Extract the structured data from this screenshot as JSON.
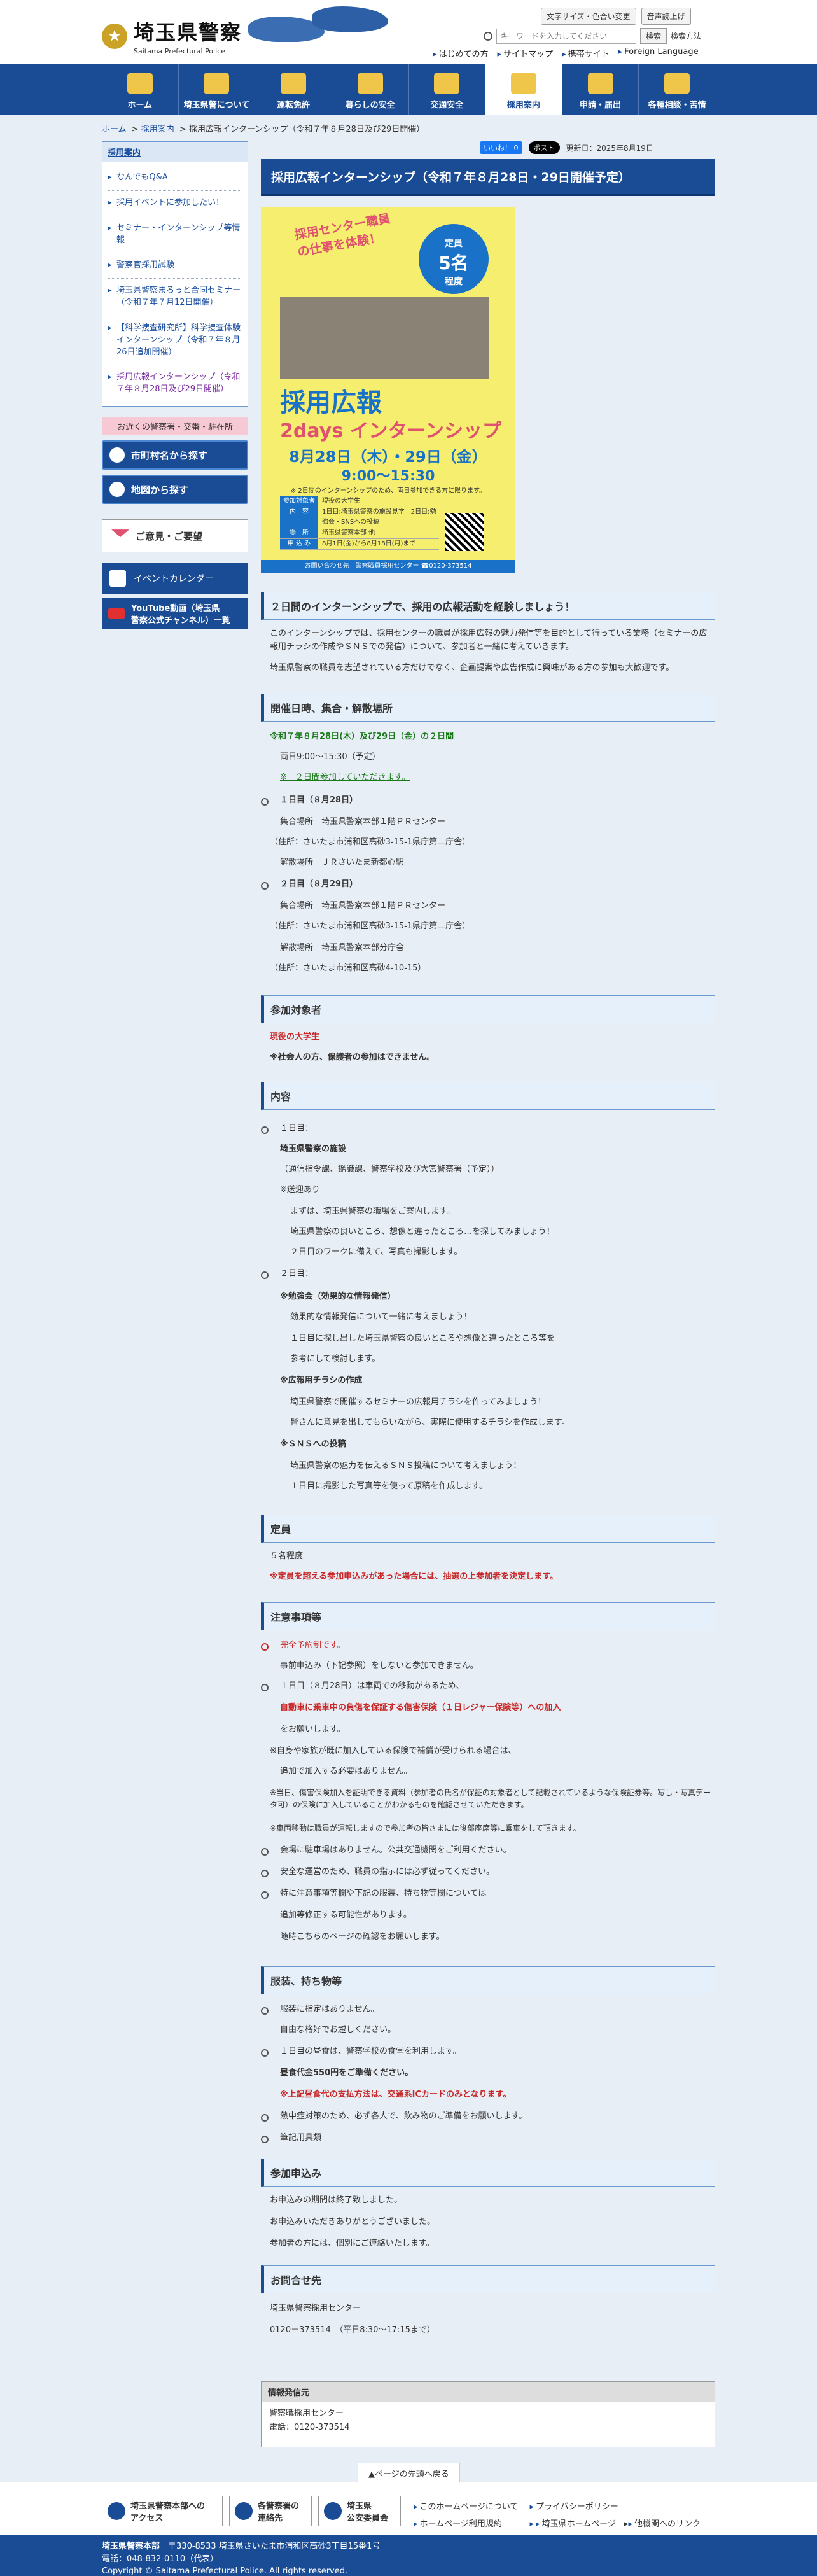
{
  "header": {
    "logo_ja": "埼玉県警察",
    "logo_en": "Saitama Prefectural Police",
    "btn_fontsize": "文字サイズ・色合い変更",
    "btn_voice": "音声読上げ",
    "search_placeholder": "キーワードを入力してください",
    "search_btn": "検索",
    "search_howto": "検索方法",
    "util": [
      "はじめての方",
      "サイトマップ",
      "携帯サイト",
      "Foreign Language"
    ]
  },
  "nav": [
    "ホーム",
    "埼玉県警について",
    "運転免許",
    "暮らしの安全",
    "交通安全",
    "採用案内",
    "申請・届出",
    "各種相談・苦情"
  ],
  "breadcrumb": {
    "home": "ホーム",
    "recruit": "採用案内",
    "current": "採用広報インターンシップ（令和７年８月28日及び29日開催）"
  },
  "sidebar": {
    "heading": "採用案内",
    "items": [
      "なんでもQ&A",
      "採用イベントに参加したい！",
      "セミナー・インターンシップ等情報",
      "警察官採用試験",
      "埼玉県警察まるっと合同セミナー（令和７年７月12日開催）",
      "【科学捜査研究所】科学捜査体験インターンシップ（令和７年８月26日追加開催）",
      "採用広報インターンシップ（令和７年８月28日及び29日開催）"
    ],
    "nearby": "お近くの警察署・交番・駐在所",
    "city_btn": "市町村名から探す",
    "map_btn": "地図から探す",
    "opinion": "ご意見・ご要望",
    "event": "イベントカレンダー",
    "youtube1": "YouTube動画（埼玉県",
    "youtube2": "警察公式チャンネル）一覧"
  },
  "meta": {
    "like": "いいね！ 0",
    "post": "ポスト",
    "updated": "更新日：2025年8月19日"
  },
  "page_title": "採用広報インターンシップ（令和７年８月28日・29日開催予定）",
  "poster": {
    "catch": "採用センター職員の仕事を体験！",
    "badge1": "定員",
    "badge2": "5名",
    "badge3": "程度",
    "title": "採用広報",
    "sub": "2days インターンシップ",
    "date": "8月28日（木）・29日（金）",
    "time": "9:00〜15:30",
    "note": "※ 2日間のインターンシップのため、両日参加できる方に限ります。",
    "rows": [
      [
        "参加対象者",
        "現役の大学生"
      ],
      [
        "内　容",
        "1日目:埼玉県警察の施設見学　2日目:勉強会・SNSへの投稿"
      ],
      [
        "場　所",
        "埼玉県警察本部 他"
      ],
      [
        "申 込 み",
        "8月1日(金)から8月18日(月)まで"
      ]
    ],
    "foot": "お問い合わせ先　警察職員採用センター ☎0120-373514"
  },
  "s1": {
    "h": "２日間のインターンシップで、採用の広報活動を経験しましょう！",
    "p1": "このインターンシップでは、採用センターの職員が採用広報の魅力発信等を目的として行っている業務（セミナーの広報用チラシの作成やＳＮＳでの発信）について、参加者と一緒に考えていきます。",
    "p2": "埼玉県警察の職員を志望されている方だけでなく、企画提案や広告作成に興味がある方の参加も大歓迎です。"
  },
  "s2": {
    "h": "開催日時、集合・解散場所",
    "date": "令和７年８月28日(木）及び29日（金）の２日間",
    "time": "両日9:00〜15:30（予定）",
    "note": "※　２日間参加していただきます。",
    "d1": "１日目（８月28日）",
    "d1a": "集合場所　埼玉県警察本部１階ＰＲセンター",
    "d1b": "（住所：さいたま市浦和区高砂3-15-1県庁第二庁舎）",
    "d1c": "解散場所　ＪＲさいたま新都心駅",
    "d2": "２日目（８月29日）",
    "d2a": "集合場所　埼玉県警察本部１階ＰＲセンター",
    "d2b": "（住所：さいたま市浦和区高砂3-15-1県庁第二庁舎）",
    "d2c": "解散場所　埼玉県警察本部分庁舎",
    "d2d": "（住所：さいたま市浦和区高砂4-10-15）"
  },
  "s3": {
    "h": "参加対象者",
    "p1": "現役の大学生",
    "p2": "※社会人の方、保護者の参加はできません。"
  },
  "s4": {
    "h": "内容",
    "day1": "１日目：",
    "day1a": "埼玉県警察の施設",
    "day1b": "（通信指令課、鑑識課、警察学校及び大宮警察署（予定））",
    "day1c": "※送迎あり",
    "day1d": "まずは、埼玉県警察の職場をご案内します。",
    "day1e": "埼玉県警察の良いところ、想像と違ったところ…を探してみましょう！",
    "day1f": "２日目のワークに備えて、写真も撮影します。",
    "day2": "２日目：",
    "w1": "※勉強会（効果的な情報発信）",
    "w1a": "効果的な情報発信について一緒に考えましょう！",
    "w1b": "１日目に探し出した埼玉県警察の良いところや想像と違ったところ等を",
    "w1c": "参考にして検討します。",
    "w2": "※広報用チラシの作成",
    "w2a": "埼玉県警察で開催するセミナーの広報用チラシを作ってみましょう！",
    "w2b": "皆さんに意見を出してもらいながら、実際に使用するチラシを作成します。",
    "w3": "※ＳＮＳへの投稿",
    "w3a": "埼玉県警察の魅力を伝えるＳＮＳ投稿について考えましょう！",
    "w3b": "１日目に撮影した写真等を使って原稿を作成します。"
  },
  "s5": {
    "h": "定員",
    "p1": "５名程度",
    "p2": "※定員を超える参加申込みがあった場合には、抽選の上参加者を決定します。"
  },
  "s6": {
    "h": "注意事項等",
    "a": "完全予約制です。",
    "a2": "事前申込み（下記参照）をしないと参加できません。",
    "b": "１日目（８月28日）は車両での移動があるため、",
    "b2": "自動車に乗車中の負傷を保証する傷害保険（１日レジャー保険等）への加入",
    "b3": "をお願いします。",
    "b4": "※自身や家族が既に加入している保険で補償が受けられる場合は、",
    "b5": "追加で加入する必要はありません。",
    "b6": "※当日、傷害保険加入を証明できる資料（参加者の氏名が保証の対象者として記載されているような保険証券等。写し・写真データ可）の保険に加入していることがわかるものを確認させていただきます。",
    "b7": "※車両移動は職員が運転しますので参加者の皆さまには後部座席等に乗車をして頂きます。",
    "c": "会場に駐車場はありません。公共交通機関をご利用ください。",
    "d": "安全な運営のため、職員の指示には必ず従ってください。",
    "e": "特に注意事項等欄や下記の服装、持ち物等欄については",
    "e2": "追加等修正する可能性があります。",
    "e3": "随時こちらのページの確認をお願いします。"
  },
  "s7": {
    "h": "服装、持ち物等",
    "a": "服装に指定はありません。",
    "a2": "自由な格好でお越しください。",
    "b": "１日目の昼食は、警察学校の食堂を利用します。",
    "b2": "昼食代金550円をご準備ください。",
    "b3": "※上記昼食代の支払方法は、交通系ICカードのみとなります。",
    "c": "熱中症対策のため、必ず各人で、飲み物のご準備をお願いします。",
    "d": "筆記用具類"
  },
  "s8": {
    "h": "参加申込み",
    "p1": "お申込みの期間は終了致しました。",
    "p2": "お申込みいただきありがとうございました。",
    "p3": "参加者の方には、個別にご連絡いたします。"
  },
  "s9": {
    "h": "お問合せ先",
    "p1": "埼玉県警察採用センター",
    "p2": "0120－373514　（平日8:30〜17:15まで）"
  },
  "info": {
    "h": "情報発信元",
    "p1": "警察職採用センター",
    "p2": "電話：0120-373514"
  },
  "pagetop": "▲ページの先頭へ戻る",
  "footer": {
    "b1a": "埼玉県警察本部への",
    "b1b": "アクセス",
    "b2a": "各警察署の",
    "b2b": "連絡先",
    "b3a": "埼玉県",
    "b3b": "公安委員会",
    "links": [
      "このホームページについて",
      "プライバシーポリシー",
      "ホームページ利用規約",
      "埼玉県ホームページ",
      "他機関へのリンク"
    ],
    "org": "埼玉県警察本部",
    "addr": "〒330-8533 埼玉県さいたま市浦和区高砂3丁目15番1号",
    "copy": "Copyright © Saitama Prefectural Police. All rights reserved.",
    "tel": "電話：048-832-0110（代表）"
  },
  "colors": {
    "brand": "#1a4c96",
    "accent_red": "#c82828",
    "accent_green": "#1a7a1a"
  }
}
